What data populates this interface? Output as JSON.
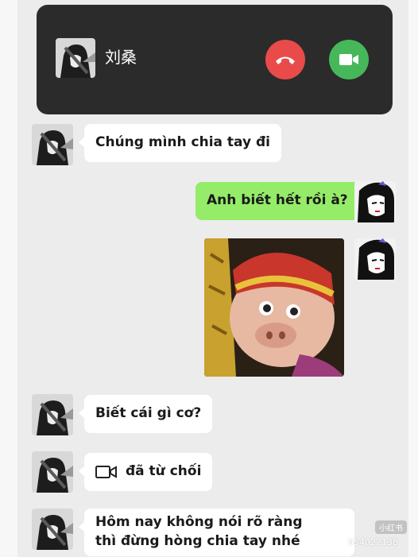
{
  "call_banner": {
    "caller_name": "刘桑",
    "decline_icon": "phone-hangup-icon",
    "accept_icon": "video-camera-icon",
    "decline_color": "#e94b4b",
    "accept_color": "#46b85a"
  },
  "messages": [
    {
      "side": "incoming",
      "text": "Chúng mình chia tay đi"
    },
    {
      "side": "outgoing",
      "text": "Anh biết hết rồi à?"
    },
    {
      "side": "outgoing",
      "type": "sticker",
      "description_icon": "pig-sticker-icon"
    },
    {
      "side": "incoming",
      "text": "Biết cái gì cơ?"
    },
    {
      "side": "incoming",
      "type": "video-call",
      "icon": "video-call-icon",
      "text": "đã từ chối"
    },
    {
      "side": "incoming",
      "text_line1": "Hôm nay không nói rõ ràng",
      "text_line2": "thì đừng hòng chia tay nhé"
    }
  ],
  "watermark": {
    "badge": "小红书",
    "id": "954022138"
  },
  "colors": {
    "outgoing_bubble": "#95ec69",
    "incoming_bubble": "#ffffff",
    "chat_background": "#ececec",
    "banner_background": "#2b2b2b"
  }
}
